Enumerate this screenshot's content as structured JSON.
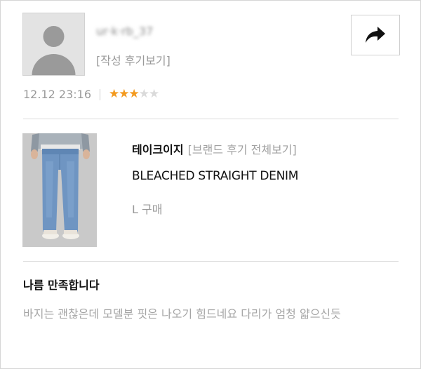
{
  "user": {
    "name": "ur·k·rb_37",
    "review_link": "[작성 후기보기]"
  },
  "share": {
    "icon": "share-arrow-icon"
  },
  "meta": {
    "datetime": "12.12 23:16",
    "rating": 3,
    "rating_max": 5,
    "star_on_color": "#f39a1f",
    "star_off_color": "#dadada"
  },
  "product": {
    "brand": "테이크이지",
    "brand_link": "[브랜드 후기 전체보기]",
    "name": "BLEACHED STRAIGHT DENIM",
    "purchase": "L 구매"
  },
  "review": {
    "title": "나름 만족합니다",
    "body": "바지는 괜찮은데 모델분 핏은 나오기 힘드네요 다리가 엄청 얇으신듯"
  }
}
